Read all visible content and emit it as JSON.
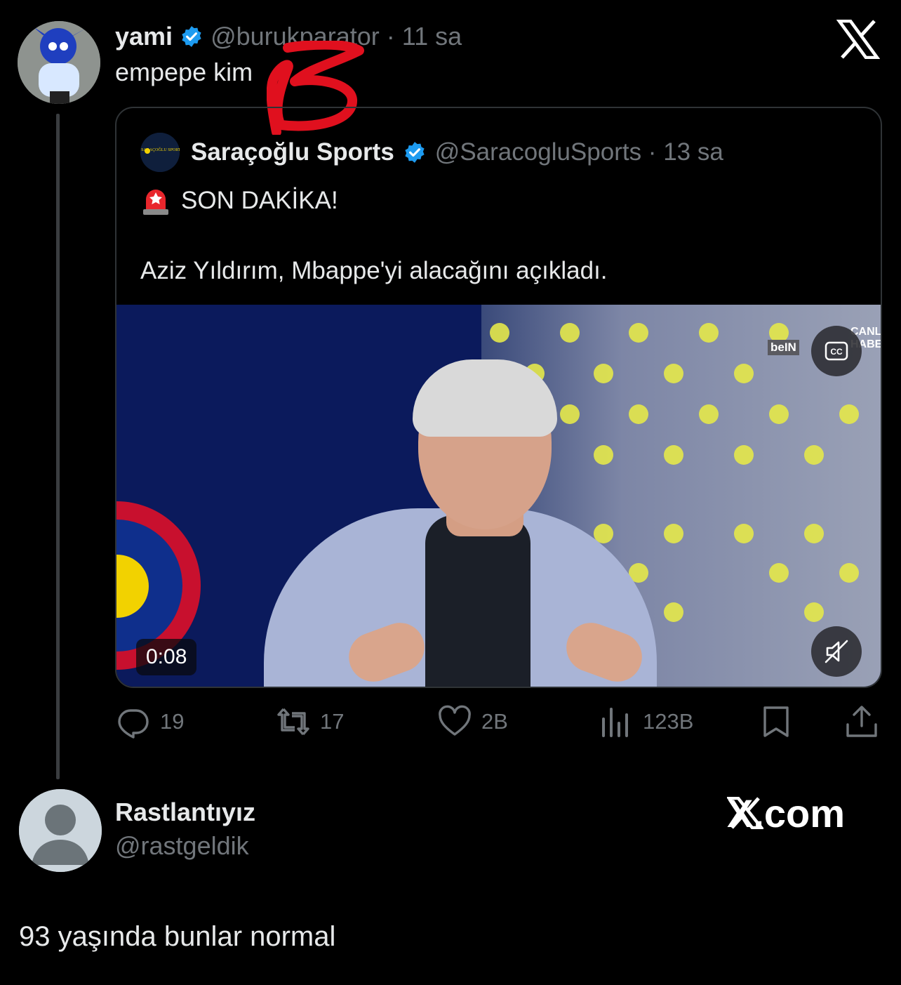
{
  "top_tweet": {
    "display_name": "yami",
    "handle_time": "@burukparator · 11 sa",
    "text": "empepe kim"
  },
  "quoted_tweet": {
    "display_name": "Saraçoğlu Sports",
    "handle_time": "@SaracogluSports · 13 sa",
    "avatar_text": "SARAÇOĞLU SPORTS",
    "line1": "SON DAKİKA!",
    "line2": "Aziz Yıldırım, Mbappe'yi alacağını açıkladı.",
    "video": {
      "timecode": "0:08",
      "channel_logo": "beIN",
      "channel_overlay_1": "CANL",
      "channel_overlay_2": "HABER",
      "cc_label": "CC"
    }
  },
  "actions": {
    "replies": "19",
    "reposts": "17",
    "likes": "2B",
    "views": "123B"
  },
  "reply": {
    "display_name": "Rastlantıyız",
    "handle": "@rastgeldik",
    "text": "93 yaşında bunlar normal"
  },
  "watermark": {
    "text": "X.com"
  },
  "colors": {
    "background": "#000000",
    "verified": "#1d9bf0",
    "muted_text": "#71767b",
    "scribble": "#e0101e"
  },
  "icons": [
    "x-logo-icon",
    "verified-badge-icon",
    "siren-icon",
    "cc-icon",
    "mute-icon",
    "reply-icon",
    "repost-icon",
    "like-icon",
    "views-icon",
    "bookmark-icon",
    "share-icon",
    "default-avatar-icon"
  ]
}
